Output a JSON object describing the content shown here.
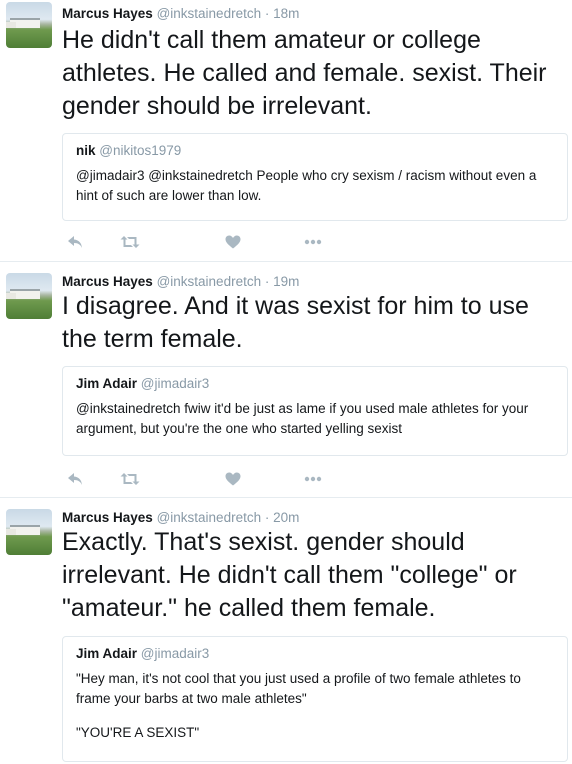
{
  "colors": {
    "muted": "#8899a6",
    "icon": "#aab8c2",
    "border": "#e1e8ed",
    "text": "#14171a"
  },
  "tweets": [
    {
      "name": "Marcus Hayes",
      "handle": "@inkstainedretch",
      "time": "18m",
      "text": "He didn't call them amateur or college athletes. He called and female. sexist. Their gender should be irrelevant.",
      "quote": {
        "name": "nik",
        "handle": "@nikitos1979",
        "text": "@jimadair3 @inkstainedretch People who cry sexism / racism without even a hint of such are lower than low."
      }
    },
    {
      "name": "Marcus Hayes",
      "handle": "@inkstainedretch",
      "time": "19m",
      "text": "I disagree. And it was sexist for him to use the term female.",
      "quote": {
        "name": "Jim Adair",
        "handle": "@jimadair3",
        "text": "@inkstainedretch fwiw it'd be just as lame if you used male athletes for your argument, but you're the one who started yelling sexist"
      }
    },
    {
      "name": "Marcus Hayes",
      "handle": "@inkstainedretch",
      "time": "20m",
      "text": "Exactly. That's sexist. gender should irrelevant. He didn't call them \"college\" or \"amateur.\" he called them female.",
      "quote": {
        "name": "Jim Adair",
        "handle": "@jimadair3",
        "text": "\"Hey man, it's not cool that you just used a profile of two female athletes to frame your barbs at two male athletes\"",
        "text2": "\"YOU'RE A SEXIST\""
      }
    }
  ],
  "separator": " · ",
  "action_icons": [
    "reply-icon",
    "retweet-icon",
    "like-icon",
    "more-icon"
  ]
}
